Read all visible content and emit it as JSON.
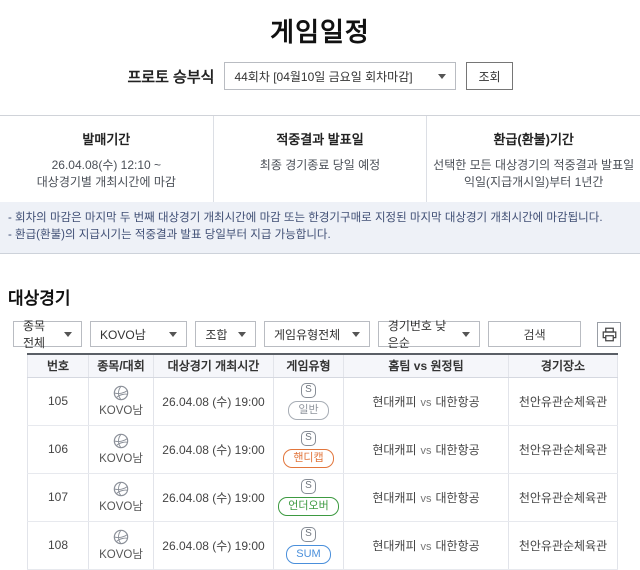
{
  "title": "게임일정",
  "round_selector": {
    "label": "프로토 승부식",
    "value": "44회차 [04월10일 금요일 회차마감]",
    "search_button": "조회"
  },
  "info_columns": [
    {
      "title": "발매기간",
      "line1": "26.04.08(수) 12:10 ~",
      "line2": "대상경기별 개최시간에 마감"
    },
    {
      "title": "적중결과 발표일",
      "line1": "최종 경기종료 당일 예정",
      "line2": ""
    },
    {
      "title": "환급(환불)기간",
      "line1": "선택한 모든 대상경기의 적중결과 발표일",
      "line2": "익일(지급개시일)부터 1년간"
    }
  ],
  "notes": [
    "- 회차의 마감은 마지막 두 번째 대상경기 개최시간에 마감 또는 한경기구매로 지정된 마지막 대상경기 개최시간에 마감됩니다.",
    "- 환급(환불)의 지급시기는 적중결과 발표 당일부터 지급 가능합니다."
  ],
  "section_title": "대상경기",
  "filters": {
    "sport": "종목전체",
    "league": "KOVO남",
    "combo": "조합",
    "game_type": "게임유형전체",
    "sort": "경기번호 낮은순",
    "search_button": "검색",
    "print_icon": "printer-icon"
  },
  "table": {
    "headers": {
      "no": "번호",
      "league": "종목/대회",
      "time": "대상경기 개최시간",
      "type": "게임유형",
      "match": "홈팀 vs 원정팀",
      "venue": "경기장소"
    },
    "s_icon_label": "S",
    "vs_label": "vs",
    "rows": [
      {
        "no": "105",
        "league": "KOVO남",
        "time": "26.04.08 (수) 19:00",
        "type": "일반",
        "type_variant": "gray",
        "home": "현대캐피",
        "away": "대한항공",
        "venue": "천안유관순체육관"
      },
      {
        "no": "106",
        "league": "KOVO남",
        "time": "26.04.08 (수) 19:00",
        "type": "핸디캡",
        "type_variant": "orange",
        "home": "현대캐피",
        "away": "대한항공",
        "venue": "천안유관순체육관"
      },
      {
        "no": "107",
        "league": "KOVO남",
        "time": "26.04.08 (수) 19:00",
        "type": "언더오버",
        "type_variant": "green",
        "home": "현대캐피",
        "away": "대한항공",
        "venue": "천안유관순체육관"
      },
      {
        "no": "108",
        "league": "KOVO남",
        "time": "26.04.08 (수) 19:00",
        "type": "SUM",
        "type_variant": "blue",
        "home": "현대캐피",
        "away": "대한항공",
        "venue": "천안유관순체육관"
      }
    ]
  },
  "colors": {
    "accent_orange": "#e2763c",
    "accent_green": "#3d9a41",
    "accent_blue": "#4a8fdb",
    "note_bg": "#eef1f7",
    "header_bg": "#f5f6fa"
  }
}
